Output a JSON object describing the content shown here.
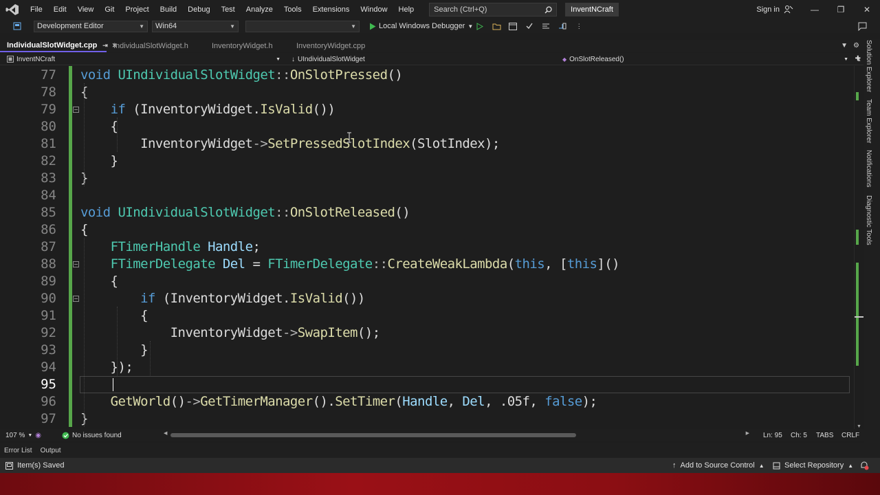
{
  "menubar": {
    "items": [
      "File",
      "Edit",
      "View",
      "Git",
      "Project",
      "Build",
      "Debug",
      "Test",
      "Analyze",
      "Tools",
      "Extensions",
      "Window",
      "Help"
    ],
    "search_placeholder": "Search (Ctrl+Q)",
    "solution_name": "InventNCraft",
    "sign_in": "Sign in"
  },
  "toolbar": {
    "configuration": "Development Editor",
    "platform": "Win64",
    "startup": "",
    "debugger": "Local Windows Debugger"
  },
  "tabs": [
    {
      "label": "IndividualSlotWidget.cpp",
      "active": true
    },
    {
      "label": "IndividualSlotWidget.h",
      "active": false
    },
    {
      "label": "InventoryWidget.h",
      "active": false
    },
    {
      "label": "InventoryWidget.cpp",
      "active": false
    }
  ],
  "navbar": {
    "project": "InventNCraft",
    "scope": "UIndividualSlotWidget",
    "member": "OnSlotReleased()"
  },
  "code": {
    "lines": [
      {
        "n": "77",
        "text": "void UIndividualSlotWidget::OnSlotPressed()"
      },
      {
        "n": "78",
        "text": "{"
      },
      {
        "n": "79",
        "text": "    if (InventoryWidget.IsValid())"
      },
      {
        "n": "80",
        "text": "    {"
      },
      {
        "n": "81",
        "text": "        InventoryWidget->SetPressedSlotIndex(SlotIndex);"
      },
      {
        "n": "82",
        "text": "    }"
      },
      {
        "n": "83",
        "text": "}"
      },
      {
        "n": "84",
        "text": ""
      },
      {
        "n": "85",
        "text": "void UIndividualSlotWidget::OnSlotReleased()"
      },
      {
        "n": "86",
        "text": "{"
      },
      {
        "n": "87",
        "text": "    FTimerHandle Handle;"
      },
      {
        "n": "88",
        "text": "    FTimerDelegate Del = FTimerDelegate::CreateWeakLambda(this, [this]()"
      },
      {
        "n": "89",
        "text": "    {"
      },
      {
        "n": "90",
        "text": "        if (InventoryWidget.IsValid())"
      },
      {
        "n": "91",
        "text": "        {"
      },
      {
        "n": "92",
        "text": "            InventoryWidget->SwapItem();"
      },
      {
        "n": "93",
        "text": "        }"
      },
      {
        "n": "94",
        "text": "    });"
      },
      {
        "n": "95",
        "text": ""
      },
      {
        "n": "96",
        "text": "    GetWorld()->GetTimerManager().SetTimer(Handle, Del, .05f, false);"
      },
      {
        "n": "97",
        "text": "}"
      }
    ],
    "current_line": "95"
  },
  "editor_status": {
    "zoom": "107 %",
    "issues": "No issues found",
    "line": "Ln: 95",
    "col": "Ch: 5",
    "indent": "TABS",
    "eol": "CRLF"
  },
  "panels": {
    "tabs": [
      "Error List",
      "Output"
    ]
  },
  "statusbar": {
    "message": "Item(s) Saved",
    "source_control": "Add to Source Control",
    "repository": "Select Repository"
  },
  "sidepanel": {
    "tabs": [
      "Solution Explorer",
      "Team Explorer",
      "Notifications",
      "Diagnostic Tools"
    ]
  },
  "colors": {
    "keyword": "#569cd6",
    "type": "#4ec9b0",
    "function": "#dcdcaa",
    "variable": "#9cdcfe",
    "number": "#b5cea8",
    "accent": "#7160e8",
    "change_bar": "#57a64a",
    "bottom_strip": "#9a1016"
  }
}
